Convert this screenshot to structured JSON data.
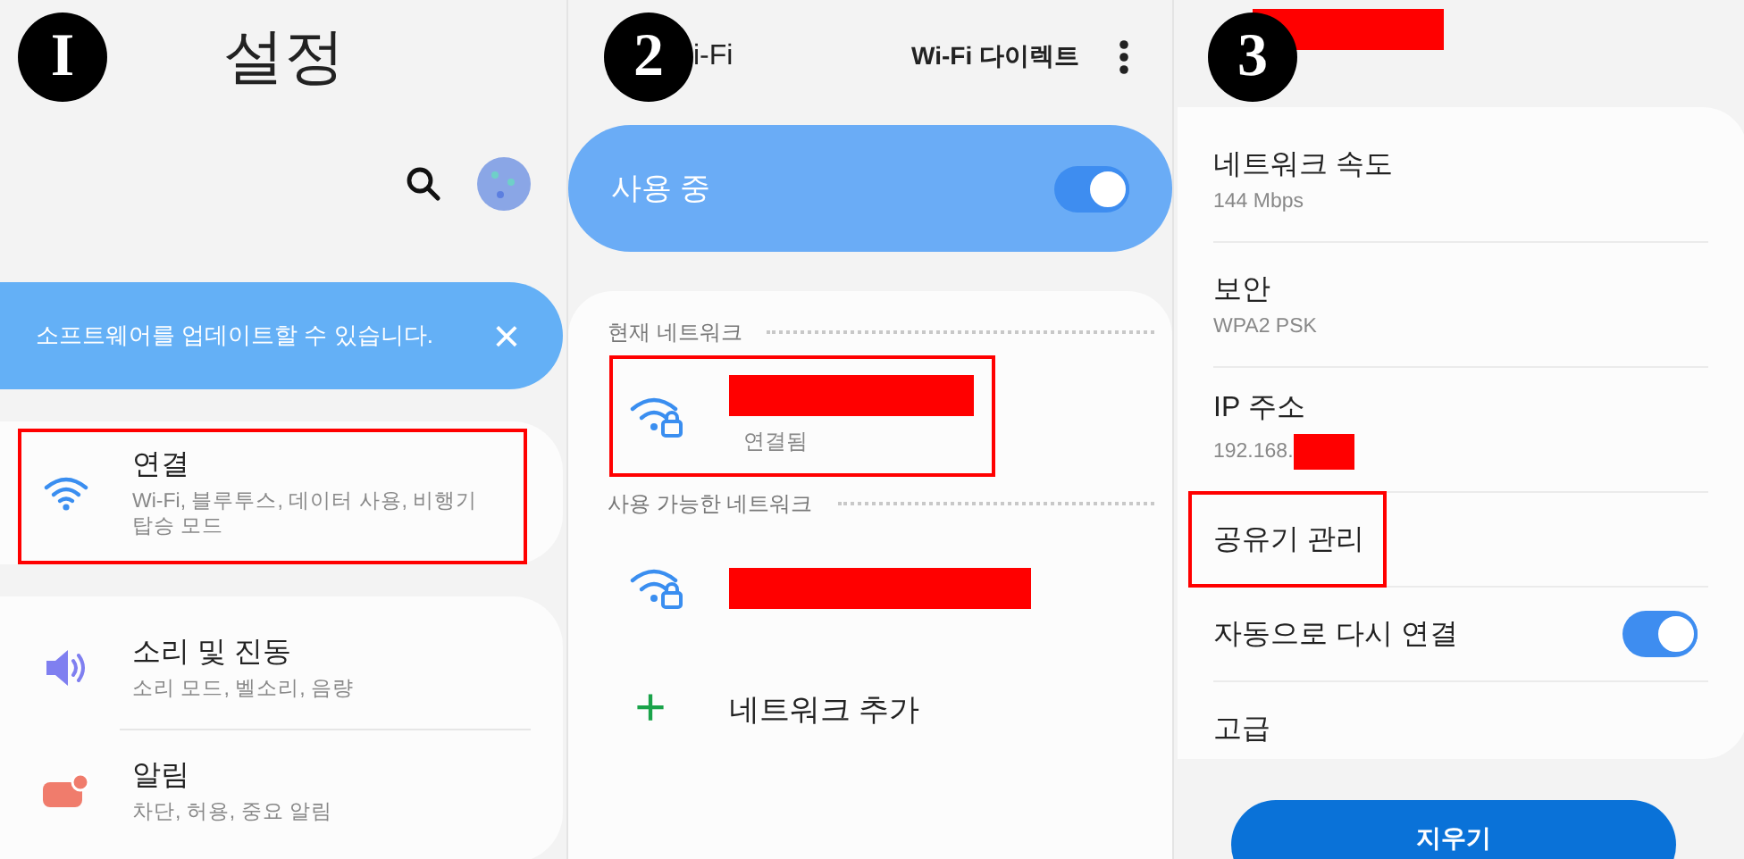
{
  "settings_screen": {
    "step_badge": "I",
    "title": "설정",
    "banner": {
      "text": "소프트웨어를 업데이트할 수 있습니다.",
      "close": "×"
    },
    "groups": [
      {
        "items": [
          {
            "kind": "wifi",
            "title": "연결",
            "subtitle": "Wi-Fi, 블루투스, 데이터 사용, 비행기 탑승 모드",
            "highlighted": true
          }
        ]
      },
      {
        "items": [
          {
            "kind": "sound",
            "title": "소리 및 진동",
            "subtitle": "소리 모드, 벨소리, 음량",
            "highlighted": false
          },
          {
            "kind": "notification",
            "title": "알림",
            "subtitle": "차단, 허용, 중요 알림",
            "highlighted": false
          }
        ]
      }
    ]
  },
  "wifi_screen": {
    "step_badge": "2",
    "title": "i-Fi",
    "action": "Wi-Fi 다이렉트",
    "master_switch": {
      "label": "사용 중",
      "on": true
    },
    "sections": [
      {
        "header": "현재 네트워크",
        "networks": [
          {
            "redacted": true,
            "status": "연결됨",
            "highlighted": true
          }
        ]
      },
      {
        "header": "사용 가능한 네트워크",
        "networks": [
          {
            "redacted": true,
            "highlighted": false
          }
        ]
      }
    ],
    "add_network": {
      "icon": "+",
      "label": "네트워크 추가"
    }
  },
  "network_details_screen": {
    "step_badge": "3",
    "title_redacted": true,
    "rows": [
      {
        "kind": "info",
        "label": "네트워크 속도",
        "value": "144 Mbps",
        "highlighted": false
      },
      {
        "kind": "info",
        "label": "보안",
        "value": "WPA2 PSK",
        "highlighted": false
      },
      {
        "kind": "info",
        "label": "IP 주소",
        "value": "192.168.",
        "value_redacted": true,
        "highlighted": false
      },
      {
        "kind": "link",
        "label": "공유기 관리",
        "highlighted": true
      },
      {
        "kind": "toggle",
        "label": "자동으로 다시 연결",
        "on": true,
        "highlighted": false
      },
      {
        "kind": "link",
        "label": "고급",
        "highlighted": false
      }
    ],
    "button": "지우기"
  }
}
